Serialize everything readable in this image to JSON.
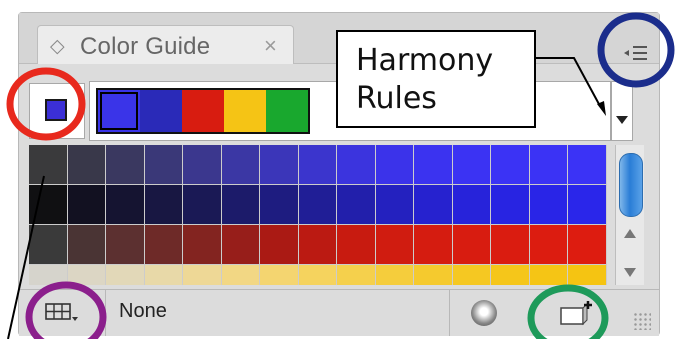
{
  "panel": {
    "tab_title": "Color Guide",
    "tab_icon": "diamond-star-icon",
    "close_icon": "close-icon",
    "menu_icon": "panel-menu-icon"
  },
  "base_color": "#3b2fd6",
  "harmony_strip": [
    "#3a34e8",
    "#2a2ab8",
    "#d81c10",
    "#f5c415",
    "#19a82e"
  ],
  "callout": {
    "line1": "Harmony",
    "line2": "Rules"
  },
  "variation_grid": {
    "rows": [
      [
        "#3a3a3c",
        "#39384a",
        "#3a3860",
        "#3a3878",
        "#3b378e",
        "#3b37a4",
        "#3b36b9",
        "#3b35cd",
        "#3b34de",
        "#3b33ea",
        "#3b33f0",
        "#3b33f3",
        "#3b33f5",
        "#3b33f5",
        "#3b33f6"
      ],
      [
        "#101012",
        "#121121",
        "#151431",
        "#181742",
        "#1a1955",
        "#1c1b6a",
        "#1e1c80",
        "#201e96",
        "#221fab",
        "#2421bf",
        "#2622cf",
        "#2723da",
        "#2824e2",
        "#2925e7",
        "#2a26ea"
      ],
      [
        "#3a3a3a",
        "#4a3434",
        "#5c3030",
        "#6e2a28",
        "#832420",
        "#971e1a",
        "#aa1a14",
        "#bb1a12",
        "#c81b10",
        "#d01c10",
        "#d51c10",
        "#d81c10",
        "#da1c10",
        "#dc1c10",
        "#dd1c10"
      ],
      [
        "#d6d4cc",
        "#dcd6c4",
        "#e2d8b8",
        "#e8d9a8",
        "#eed896",
        "#f2d784",
        "#f4d570",
        "#f5d35e",
        "#f5d04c",
        "#f5cd3c",
        "#f5ca2e",
        "#f5c822",
        "#f5c61a",
        "#f5c515",
        "#f5c412"
      ]
    ]
  },
  "bottom": {
    "limit_label": "None",
    "grid_icon": "color-grid-icon",
    "swatch_icon": "edit-colors-icon",
    "new_group_icon": "new-swatch-group-icon"
  },
  "annotation_colors": {
    "red_circle": "#e8291d",
    "blue_circle": "#1b2d8c",
    "purple_circle": "#8b1f8c",
    "green_circle": "#1e9a5a"
  }
}
